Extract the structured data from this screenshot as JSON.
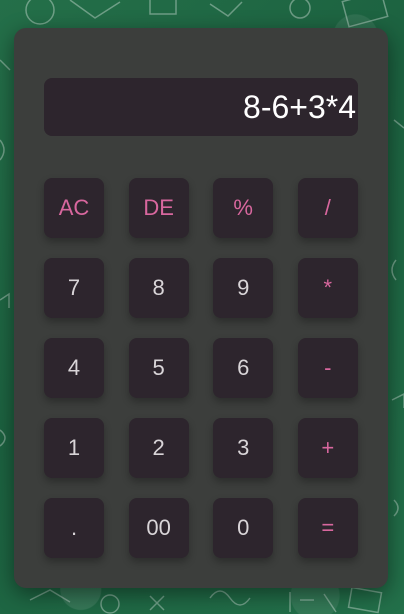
{
  "display": {
    "expression": "8-6+3*4"
  },
  "colors": {
    "board": "#1f6b44",
    "panel": "#3c3e3c",
    "key": "#2d252d",
    "accent": "#d8679e",
    "digit": "#d9d5d8",
    "display_text": "#ffffff"
  },
  "keys": [
    {
      "label": "AC",
      "name": "all-clear-button",
      "accent": true
    },
    {
      "label": "DE",
      "name": "delete-button",
      "accent": true
    },
    {
      "label": "%",
      "name": "percent-button",
      "accent": true
    },
    {
      "label": "/",
      "name": "divide-button",
      "accent": true
    },
    {
      "label": "7",
      "name": "digit-7-button",
      "accent": false
    },
    {
      "label": "8",
      "name": "digit-8-button",
      "accent": false
    },
    {
      "label": "9",
      "name": "digit-9-button",
      "accent": false
    },
    {
      "label": "*",
      "name": "multiply-button",
      "accent": true
    },
    {
      "label": "4",
      "name": "digit-4-button",
      "accent": false
    },
    {
      "label": "5",
      "name": "digit-5-button",
      "accent": false
    },
    {
      "label": "6",
      "name": "digit-6-button",
      "accent": false
    },
    {
      "label": "-",
      "name": "subtract-button",
      "accent": true
    },
    {
      "label": "1",
      "name": "digit-1-button",
      "accent": false
    },
    {
      "label": "2",
      "name": "digit-2-button",
      "accent": false
    },
    {
      "label": "3",
      "name": "digit-3-button",
      "accent": false
    },
    {
      "label": "+",
      "name": "add-button",
      "accent": true
    },
    {
      "label": ".",
      "name": "decimal-point-button",
      "accent": false
    },
    {
      "label": "00",
      "name": "double-zero-button",
      "accent": false
    },
    {
      "label": "0",
      "name": "digit-0-button",
      "accent": false
    },
    {
      "label": "=",
      "name": "equals-button",
      "accent": true
    }
  ]
}
